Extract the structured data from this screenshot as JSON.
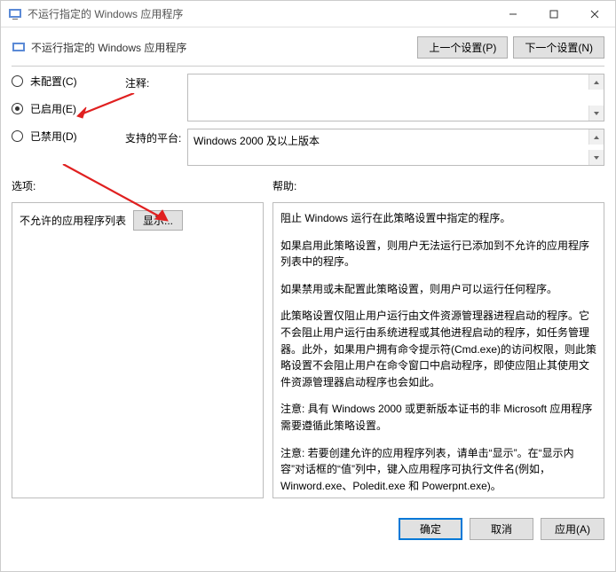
{
  "window": {
    "title": "不运行指定的 Windows 应用程序"
  },
  "header": {
    "title": "不运行指定的 Windows 应用程序",
    "prev": "上一个设置(P)",
    "next": "下一个设置(N)"
  },
  "config": {
    "not_configured": "未配置(C)",
    "enabled": "已启用(E)",
    "disabled": "已禁用(D)",
    "comment_label": "注释:",
    "comment_value": "",
    "supported_label": "支持的平台:",
    "supported_value": "Windows 2000 及以上版本",
    "selected": "enabled"
  },
  "sections": {
    "options": "选项:",
    "help": "帮助:"
  },
  "options": {
    "list_label": "不允许的应用程序列表",
    "show": "显示..."
  },
  "help_paragraphs": [
    "阻止 Windows 运行在此策略设置中指定的程序。",
    "如果启用此策略设置，则用户无法运行已添加到不允许的应用程序列表中的程序。",
    "如果禁用或未配置此策略设置，则用户可以运行任何程序。",
    "此策略设置仅阻止用户运行由文件资源管理器进程启动的程序。它不会阻止用户运行由系统进程或其他进程启动的程序，如任务管理器。此外，如果用户拥有命令提示符(Cmd.exe)的访问权限，则此策略设置不会阻止用户在命令窗口中启动程序，即使应阻止其使用文件资源管理器启动程序也会如此。",
    "注意: 具有 Windows 2000 或更新版本证书的非 Microsoft 应用程序需要遵循此策略设置。",
    "注意: 若要创建允许的应用程序列表，请单击“显示”。在“显示内容”对话框的“值”列中，键入应用程序可执行文件名(例如，Winword.exe、Poledit.exe 和 Powerpnt.exe)。"
  ],
  "footer": {
    "ok": "确定",
    "cancel": "取消",
    "apply": "应用(A)"
  }
}
